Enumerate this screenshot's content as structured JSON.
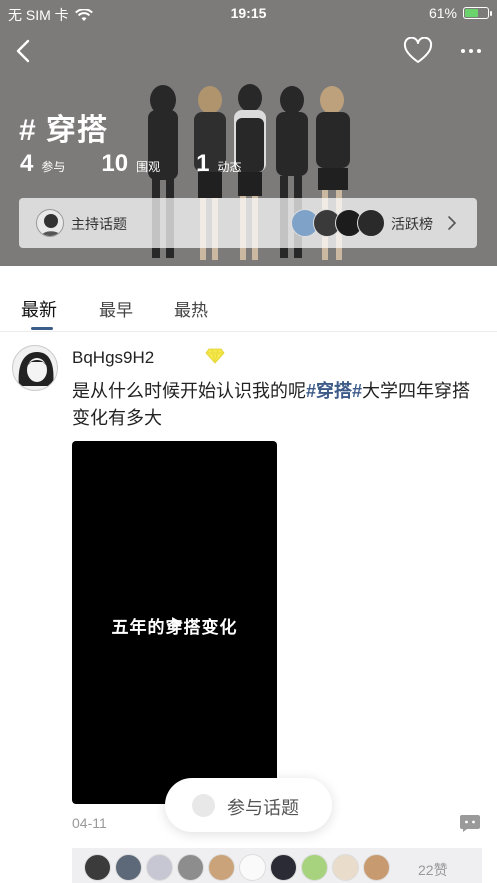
{
  "status_bar": {
    "carrier": "无 SIM 卡",
    "time": "19:15",
    "battery": "61%",
    "battery_level": 0.61,
    "wifi_icon": "wifi-icon"
  },
  "nav": {
    "back_icon": "chevron-left-icon",
    "favorite_icon": "heart-icon",
    "more_icon": "more-dots-icon"
  },
  "topic": {
    "title": "# 穿搭",
    "stats": [
      {
        "value": "4",
        "label": "参与"
      },
      {
        "value": "10",
        "label": "围观"
      },
      {
        "value": "1",
        "label": "动态"
      }
    ],
    "host_label": "主持话题",
    "active_label": "活跃榜"
  },
  "tabs": [
    {
      "label": "最新",
      "active": true
    },
    {
      "label": "最早",
      "active": false
    },
    {
      "label": "最热",
      "active": false
    }
  ],
  "post": {
    "username": "BqHgs9H2",
    "text_before": "是从什么时候开始认识我的呢",
    "hashtag": "#穿搭#",
    "text_after": "大学四年穿搭变化有多大",
    "video_caption": "五年的穿搭变化",
    "date": "04-11",
    "likes": "22赞"
  },
  "join_button": {
    "label": "参与话题"
  },
  "colors": {
    "accent": "#3a5d8a",
    "hashtag": "#3d5b88",
    "header_bg": "#7d7a7a",
    "diamond": "#f5e84a",
    "battery_fill": "#6bd36b"
  }
}
